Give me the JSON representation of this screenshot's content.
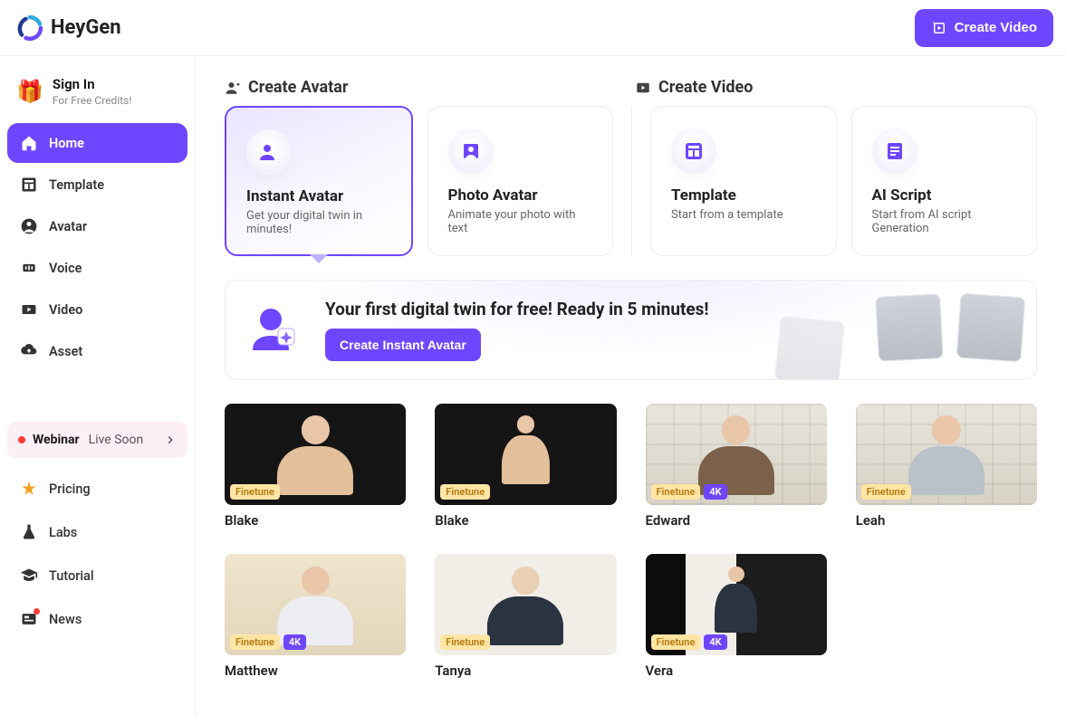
{
  "header": {
    "brand": "HeyGen",
    "create_video": "Create Video"
  },
  "sidebar": {
    "signin": {
      "title": "Sign In",
      "sub": "For Free Credits!"
    },
    "items": [
      {
        "label": "Home",
        "active": true
      },
      {
        "label": "Template"
      },
      {
        "label": "Avatar"
      },
      {
        "label": "Voice"
      },
      {
        "label": "Video"
      },
      {
        "label": "Asset"
      }
    ],
    "webinar": {
      "bold": "Webinar",
      "light": "Live Soon"
    },
    "secondary": [
      {
        "label": "Pricing"
      },
      {
        "label": "Labs"
      },
      {
        "label": "Tutorial"
      },
      {
        "label": "News"
      }
    ]
  },
  "sections": {
    "create_avatar": "Create Avatar",
    "create_video": "Create Video"
  },
  "cards": {
    "instant_avatar": {
      "title": "Instant Avatar",
      "sub": "Get your digital twin in minutes!"
    },
    "photo_avatar": {
      "title": "Photo Avatar",
      "sub": "Animate your photo with text"
    },
    "template": {
      "title": "Template",
      "sub": "Start from a template"
    },
    "ai_script": {
      "title": "AI Script",
      "sub": "Start from AI script Generation"
    }
  },
  "banner": {
    "title": "Your first digital twin for free! Ready in 5 minutes!",
    "cta": "Create Instant Avatar"
  },
  "tags": {
    "finetune": "Finetune",
    "fourk": "4K"
  },
  "avatars": {
    "blake1": {
      "name": "Blake"
    },
    "blake2": {
      "name": "Blake"
    },
    "edward": {
      "name": "Edward"
    },
    "leah": {
      "name": "Leah"
    },
    "matthew": {
      "name": "Matthew"
    },
    "tanya": {
      "name": "Tanya"
    },
    "vera": {
      "name": "Vera"
    }
  }
}
